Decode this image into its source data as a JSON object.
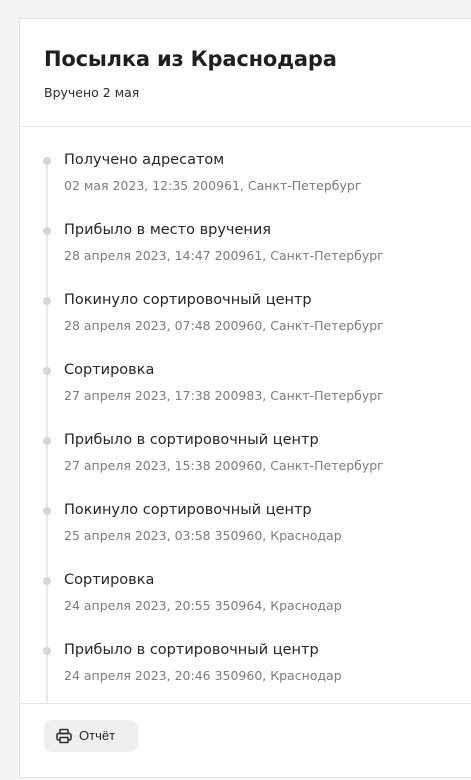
{
  "parcel": {
    "title": "Посылка из Краснодара",
    "status": "Вручено 2 мая"
  },
  "events": [
    {
      "status": "Получено адресатом",
      "detail": "02 мая 2023, 12:35 200961, Санкт-Петербург"
    },
    {
      "status": "Прибыло в место вручения",
      "detail": "28 апреля 2023, 14:47 200961, Санкт-Петербург"
    },
    {
      "status": "Покинуло сортировочный центр",
      "detail": "28 апреля 2023, 07:48 200960, Санкт-Петербург"
    },
    {
      "status": "Сортировка",
      "detail": "27 апреля 2023, 17:38 200983, Санкт-Петербург"
    },
    {
      "status": "Прибыло в сортировочный центр",
      "detail": "27 апреля 2023, 15:38 200960, Санкт-Петербург"
    },
    {
      "status": "Покинуло сортировочный центр",
      "detail": "25 апреля 2023, 03:58 350960, Краснодар"
    },
    {
      "status": "Сортировка",
      "detail": "24 апреля 2023, 20:55 350964, Краснодар"
    },
    {
      "status": "Прибыло в сортировочный центр",
      "detail": "24 апреля 2023, 20:46 350960, Краснодар"
    }
  ],
  "footer": {
    "report_label": "Отчёт",
    "report_icon": "printer-icon"
  }
}
